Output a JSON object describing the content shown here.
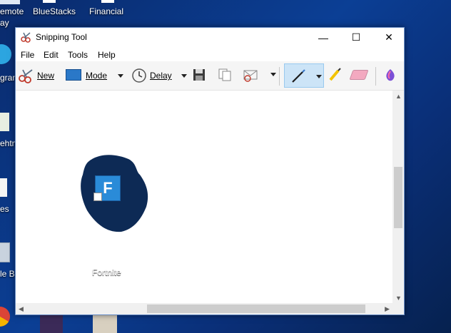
{
  "desktop": {
    "top_labels": [
      "emote",
      "BlueStacks",
      "Financial"
    ],
    "left_labels": [
      "ay",
      "gram",
      "ehtm",
      "es",
      "le B"
    ]
  },
  "window": {
    "title": "Snipping Tool",
    "controls": {
      "minimize": "—",
      "maximize": "☐",
      "close": "✕"
    }
  },
  "menu": [
    "File",
    "Edit",
    "Tools",
    "Help"
  ],
  "toolbar": {
    "new_label": "New",
    "mode_label": "Mode",
    "delay_label": "Delay",
    "icons": [
      "scissors-icon",
      "mode-icon",
      "clock-icon",
      "save-icon",
      "copy-icon",
      "send-email-icon",
      "pen-icon",
      "highlighter-icon",
      "eraser-icon",
      "paint3d-icon"
    ]
  },
  "snip": {
    "icon_label": "Fortnite",
    "colors": {
      "blob": "#0d2a55",
      "tile": "#2a8bd8"
    }
  }
}
